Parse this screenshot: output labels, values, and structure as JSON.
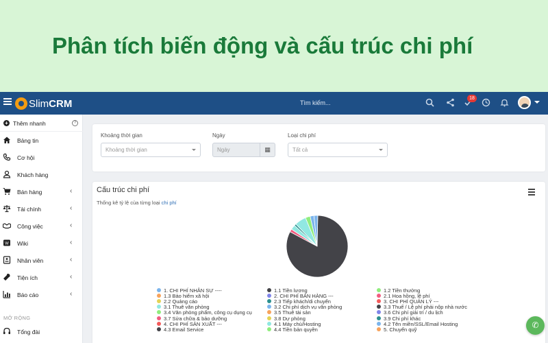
{
  "banner": {
    "title": "Phân tích biến động và cấu trúc chi phí"
  },
  "topbar": {
    "logo_plain": "Slim",
    "logo_bold": "CRM",
    "search_placeholder": "Tìm kiếm...",
    "todo_badge": "18"
  },
  "sidebar": {
    "quick_add": "Thêm nhanh",
    "items": [
      {
        "label": "Bảng tin",
        "icon": "home-icon",
        "has_submenu": false
      },
      {
        "label": "Cơ hội",
        "icon": "phone-icon",
        "has_submenu": false
      },
      {
        "label": "Khách hàng",
        "icon": "user-icon",
        "has_submenu": false
      },
      {
        "label": "Bán hàng",
        "icon": "cart-icon",
        "has_submenu": true
      },
      {
        "label": "Tài chính",
        "icon": "scale-icon",
        "has_submenu": true
      },
      {
        "label": "Công việc",
        "icon": "handshake-icon",
        "has_submenu": true
      },
      {
        "label": "Wiki",
        "icon": "wiki-icon",
        "has_submenu": true
      },
      {
        "label": "Nhân viên",
        "icon": "id-card-icon",
        "has_submenu": true
      },
      {
        "label": "Tiện ích",
        "icon": "wrench-icon",
        "has_submenu": true
      },
      {
        "label": "Báo cáo",
        "icon": "bar-chart-icon",
        "has_submenu": true
      }
    ],
    "section_label": "MỞ RỘNG",
    "extra_items": [
      {
        "label": "Tổng đài",
        "icon": "headset-icon"
      }
    ]
  },
  "filters": {
    "period": {
      "label": "Khoảng thời gian",
      "placeholder": "Khoảng thời gian"
    },
    "date": {
      "label": "Ngày",
      "placeholder": "Ngày"
    },
    "cost_type": {
      "label": "Loại chi phí",
      "placeholder": "Tất cả"
    }
  },
  "chart_card": {
    "title": "Cấu trúc chi phí",
    "subtitle_prefix": "Thống kê tỷ lệ của từng loại",
    "subtitle_highlight": "chi phí"
  },
  "chart_data": {
    "type": "pie",
    "title": "Cấu trúc chi phí",
    "legend_position": "bottom",
    "legend": [
      {
        "name": "1. CHI PHÍ NHÂN SỰ ----",
        "color": "#7cb5ec"
      },
      {
        "name": "1.1 Tiền lương",
        "color": "#434348"
      },
      {
        "name": "1.2 Tiền thưởng",
        "color": "#90ed7d"
      },
      {
        "name": "1.3 Bảo hiểm xã hội",
        "color": "#f7a35c"
      },
      {
        "name": "2. CHI PHÍ BÁN HÀNG ---",
        "color": "#8085e9"
      },
      {
        "name": "2.1 Hoa hồng, lệ phí",
        "color": "#f15c80"
      },
      {
        "name": "2.2 Quảng cáo",
        "color": "#e4d354"
      },
      {
        "name": "2.3 Tiếp khách/di chuyển",
        "color": "#2b908f"
      },
      {
        "name": "3. CHI PHÍ QUẢN LÝ ---",
        "color": "#f45b5b"
      },
      {
        "name": "3.1 Thuê văn phòng",
        "color": "#91e8e1"
      },
      {
        "name": "3.2 Chi phí dịch vụ văn phòng",
        "color": "#7cb5ec"
      },
      {
        "name": "3.3 Thuế / Lệ phí phải nộp nhà nước",
        "color": "#434348"
      },
      {
        "name": "3.4 Văn phòng phẩm, công cụ dụng cụ",
        "color": "#90ed7d"
      },
      {
        "name": "3.5 Thuê tài sản",
        "color": "#f7a35c"
      },
      {
        "name": "3.6 Chi phí giải trí / du lịch",
        "color": "#8085e9"
      },
      {
        "name": "3.7 Sửa chữa & bảo dưỡng",
        "color": "#f15c80"
      },
      {
        "name": "3.8 Dự phòng",
        "color": "#e4d354"
      },
      {
        "name": "3.9 Chi phí khác",
        "color": "#2b908f"
      },
      {
        "name": "4. CHI PHÍ SẢN XUẤT ---",
        "color": "#f45b5b"
      },
      {
        "name": "4.1 Máy chủ/Hosting",
        "color": "#91e8e1"
      },
      {
        "name": "4.2 Tên miền/SSL/Email Hosting",
        "color": "#7cb5ec"
      },
      {
        "name": "4.3 Email Service",
        "color": "#434348"
      },
      {
        "name": "4.4 Tiền bản quyền",
        "color": "#90ed7d"
      },
      {
        "name": "5. Chuyển quỹ",
        "color": "#f7a35c"
      }
    ],
    "slices": [
      {
        "name": "1.1 Tiền lương",
        "value": 82.5,
        "color": "#434348"
      },
      {
        "name": "2.1 Hoa hồng, lệ phí",
        "value": 1.5,
        "color": "#f15c80"
      },
      {
        "name": "3.1 Thuê văn phòng",
        "value": 2.5,
        "color": "#91e8e1"
      },
      {
        "name": "3.9 Chi phí khác",
        "value": 1.0,
        "color": "#2b908f"
      },
      {
        "name": "4.1 Máy chủ/Hosting",
        "value": 6.0,
        "color": "#91e8e1"
      },
      {
        "name": "4.4 Tiền bản quyền",
        "value": 2.5,
        "color": "#90ed7d"
      },
      {
        "name": "4.2 Tên miền/SSL/Email Hosting",
        "value": 2.0,
        "color": "#7cb5ec"
      },
      {
        "name": "1. CHI PHÍ NHÂN SỰ ----",
        "value": 2.0,
        "color": "#7cb5ec"
      }
    ]
  }
}
